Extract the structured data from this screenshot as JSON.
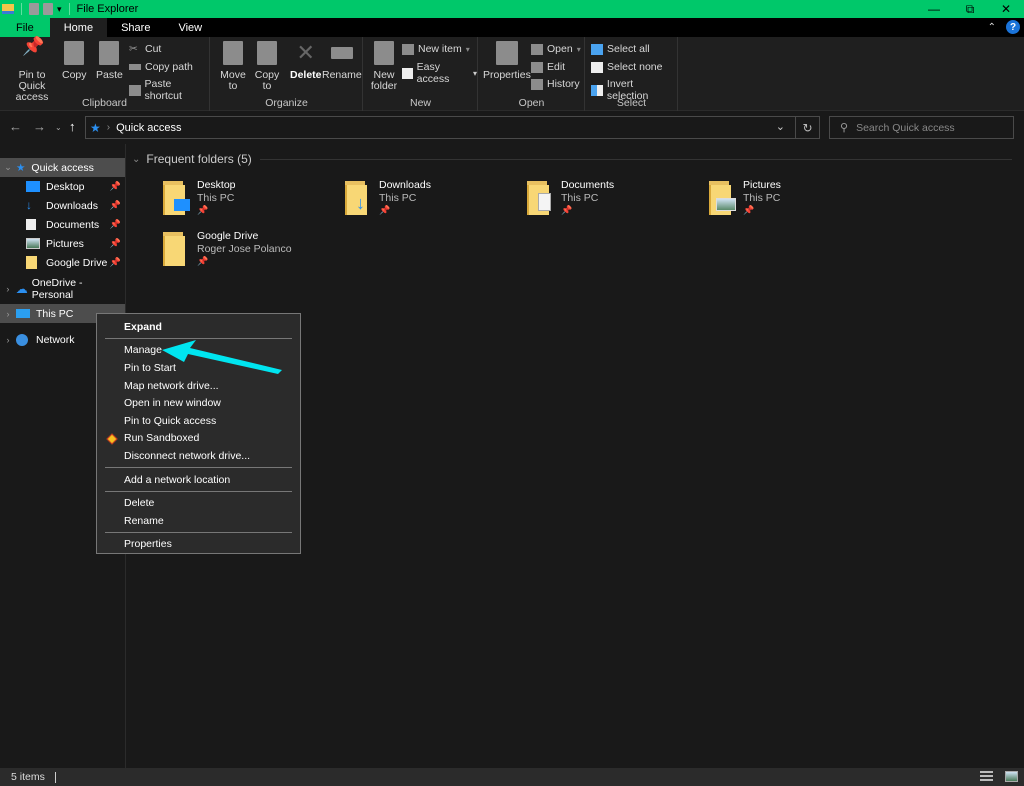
{
  "window": {
    "title": "File Explorer",
    "controls": [
      "minimize",
      "restore",
      "close"
    ]
  },
  "ribbon_tabs": [
    {
      "label": "File"
    },
    {
      "label": "Home",
      "active": true
    },
    {
      "label": "Share"
    },
    {
      "label": "View"
    }
  ],
  "ribbon": {
    "clipboard": {
      "label": "Clipboard",
      "pin_to_quick_access": "Pin to Quick access",
      "copy": "Copy",
      "paste": "Paste",
      "cut": "Cut",
      "copy_path": "Copy path",
      "paste_shortcut": "Paste shortcut"
    },
    "organize": {
      "label": "Organize",
      "move_to": "Move to",
      "copy_to": "Copy to",
      "delete": "Delete",
      "rename": "Rename"
    },
    "new": {
      "label": "New",
      "new_folder": "New folder",
      "new_item": "New item",
      "easy_access": "Easy access"
    },
    "open": {
      "label": "Open",
      "properties": "Properties",
      "open": "Open",
      "edit": "Edit",
      "history": "History"
    },
    "select": {
      "label": "Select",
      "select_all": "Select all",
      "select_none": "Select none",
      "invert_selection": "Invert selection"
    }
  },
  "address": {
    "path": "Quick access",
    "search_placeholder": "Search Quick access"
  },
  "nav_pane": {
    "quick_access": "Quick access",
    "pinned": [
      {
        "label": "Desktop"
      },
      {
        "label": "Downloads"
      },
      {
        "label": "Documents"
      },
      {
        "label": "Pictures"
      },
      {
        "label": "Google Drive"
      }
    ],
    "onedrive": "OneDrive - Personal",
    "this_pc": "This PC",
    "network": "Network"
  },
  "content": {
    "section_title": "Frequent folders (5)",
    "folders": [
      {
        "name": "Desktop",
        "location": "This PC"
      },
      {
        "name": "Downloads",
        "location": "This PC"
      },
      {
        "name": "Documents",
        "location": "This PC"
      },
      {
        "name": "Pictures",
        "location": "This PC"
      },
      {
        "name": "Google Drive",
        "location": "Roger Jose Polanco"
      }
    ]
  },
  "context_menu": {
    "items": [
      "Expand",
      "Manage",
      "Pin to Start",
      "Map network drive...",
      "Open in new window",
      "Pin to Quick access",
      "Run Sandboxed",
      "Disconnect network drive...",
      "Add a network location",
      "Delete",
      "Rename",
      "Properties"
    ]
  },
  "annotation": {
    "arrow_color": "#00e5f0",
    "points_to": "Manage"
  },
  "status": {
    "item_count": "5 items"
  },
  "colors": {
    "titlebar": "#00c86a",
    "accent_blue": "#2b8ff0",
    "folder_yellow": "#f8d775"
  }
}
